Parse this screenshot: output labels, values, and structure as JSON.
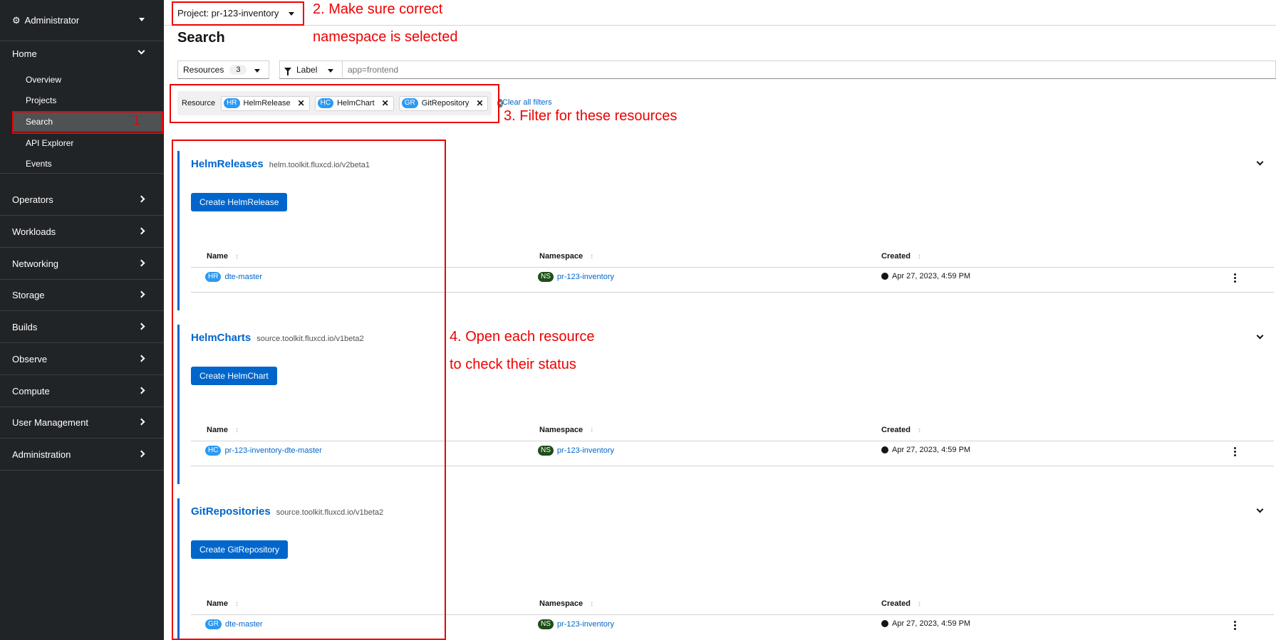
{
  "sidebar": {
    "perspective": "Administrator",
    "sections": [
      {
        "label": "Home"
      },
      {
        "label": "Operators"
      },
      {
        "label": "Workloads"
      },
      {
        "label": "Networking"
      },
      {
        "label": "Storage"
      },
      {
        "label": "Builds"
      },
      {
        "label": "Observe"
      },
      {
        "label": "Compute"
      },
      {
        "label": "User Management"
      },
      {
        "label": "Administration"
      }
    ],
    "home_items": [
      {
        "label": "Overview"
      },
      {
        "label": "Projects"
      },
      {
        "label": "Search"
      },
      {
        "label": "API Explorer"
      },
      {
        "label": "Events"
      }
    ]
  },
  "topbar": {
    "project": "Project: pr-123-inventory"
  },
  "page": {
    "title": "Search"
  },
  "filters": {
    "resources_label": "Resources",
    "resources_count": "3",
    "label_dropdown": "Label",
    "label_placeholder": "app=frontend",
    "chip_category": "Resource",
    "chips": [
      {
        "badge": "HR",
        "label": "HelmRelease"
      },
      {
        "badge": "HC",
        "label": "HelmChart"
      },
      {
        "badge": "GR",
        "label": "GitRepository"
      }
    ],
    "clear_all": "Clear all filters"
  },
  "table_headers": {
    "name": "Name",
    "namespace": "Namespace",
    "created": "Created"
  },
  "sections": [
    {
      "title": "HelmReleases",
      "api": "helm.toolkit.fluxcd.io/v2beta1",
      "create": "Create HelmRelease",
      "row": {
        "badge": "HR",
        "name": "dte-master",
        "ns_badge": "NS",
        "namespace": "pr-123-inventory",
        "created": "Apr 27, 2023, 4:59 PM"
      }
    },
    {
      "title": "HelmCharts",
      "api": "source.toolkit.fluxcd.io/v1beta2",
      "create": "Create HelmChart",
      "row": {
        "badge": "HC",
        "name": "pr-123-inventory-dte-master",
        "ns_badge": "NS",
        "namespace": "pr-123-inventory",
        "created": "Apr 27, 2023, 4:59 PM"
      }
    },
    {
      "title": "GitRepositories",
      "api": "source.toolkit.fluxcd.io/v1beta2",
      "create": "Create GitRepository",
      "row": {
        "badge": "GR",
        "name": "dte-master",
        "ns_badge": "NS",
        "namespace": "pr-123-inventory",
        "created": "Apr 27, 2023, 4:59 PM"
      }
    }
  ],
  "annotations": {
    "step1": "1",
    "step2a": "2. Make sure correct",
    "step2b": "namespace is selected",
    "step3": "3. Filter for these resources",
    "step4a": "4. Open each resource",
    "step4b": "to check their status"
  },
  "colors": {
    "accent": "#0066cc",
    "annotation": "#ee0000",
    "sidebar_bg": "#212427"
  }
}
